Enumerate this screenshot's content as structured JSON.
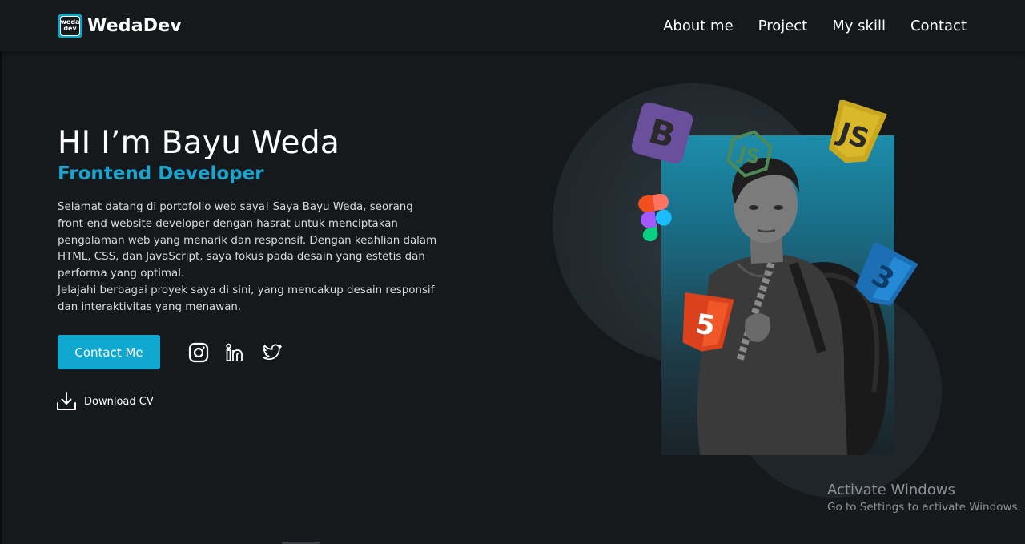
{
  "brand": {
    "logo_line1": "weda",
    "logo_line2": "dev",
    "name": "WedaDev"
  },
  "nav": {
    "items": [
      {
        "label": "About me"
      },
      {
        "label": "Project"
      },
      {
        "label": "My skill"
      },
      {
        "label": "Contact"
      }
    ]
  },
  "hero": {
    "title": "HI I’m Bayu Weda",
    "subtitle": "Frontend Developer",
    "paragraph1": "Selamat datang di portofolio web saya! Saya Bayu Weda, seorang front-end website developer dengan hasrat untuk menciptakan pengalaman web yang menarik dan responsif. Dengan keahlian dalam HTML, CSS, dan JavaScript, saya fokus pada desain yang estetis dan performa yang optimal.",
    "paragraph2": "Jelajahi berbagai proyek saya di sini, yang mencakup desain responsif dan interaktivitas yang menawan.",
    "contact_button": "Contact Me",
    "download_label": "Download CV",
    "socials": [
      {
        "icon": "instagram-icon"
      },
      {
        "icon": "linkedin-icon"
      },
      {
        "icon": "twitter-icon"
      }
    ]
  },
  "skills_badges": [
    "bootstrap-icon",
    "nodejs-icon",
    "javascript-icon",
    "figma-icon",
    "css3-icon",
    "html5-icon"
  ],
  "colors": {
    "background": "#16191c",
    "accent": "#10a8cf",
    "subtitle": "#19a5cf"
  },
  "watermark": {
    "title": "Activate Windows",
    "subtitle": "Go to Settings to activate Windows."
  }
}
